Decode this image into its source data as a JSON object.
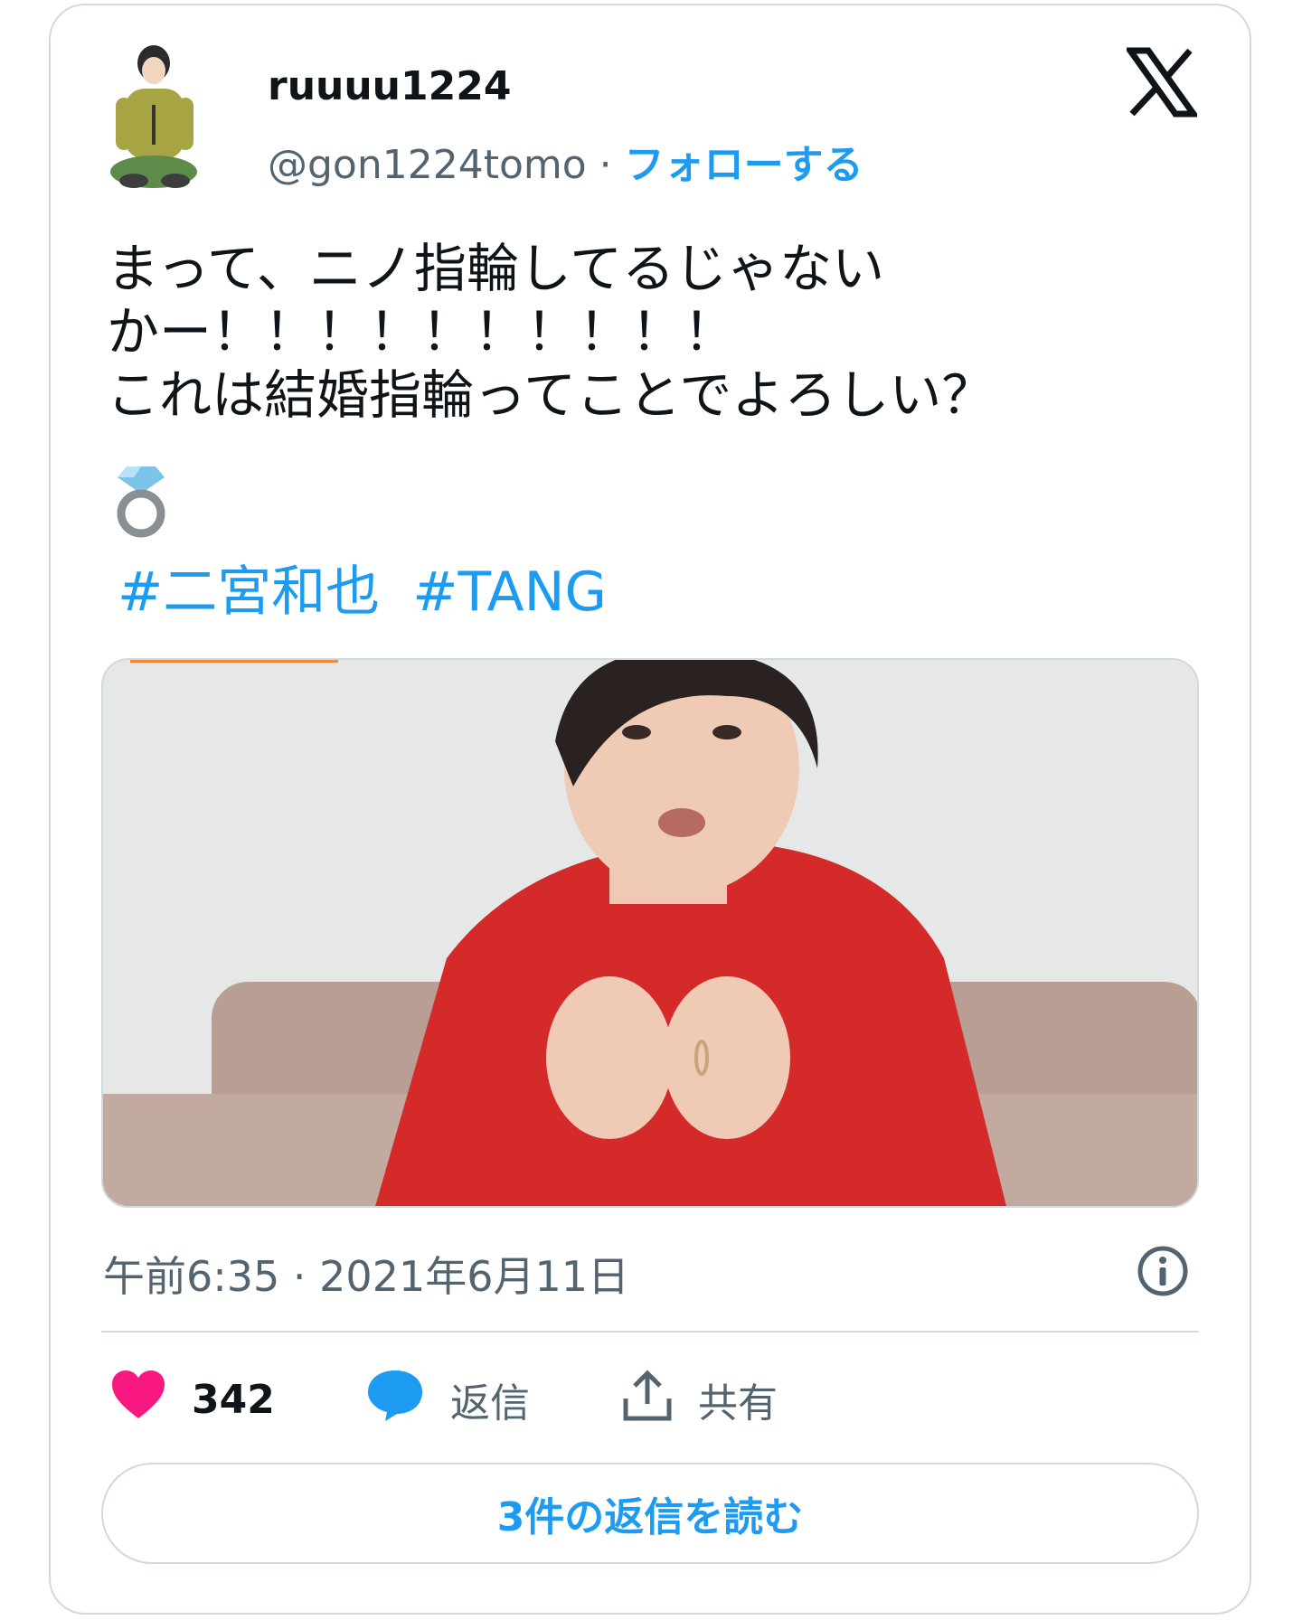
{
  "author": {
    "name": "ruuuu1224",
    "handle": "@gon1224tomo",
    "separator": "·",
    "follow_label": "フォローする"
  },
  "tweet": {
    "lines": [
      "まって、ニノ指輪してるじゃない",
      "かー！！！！！！！！！！",
      "これは結婚指輪ってことでよろしい？"
    ],
    "emoji_icon": "ring-icon",
    "hashtags": [
      "#二宮和也",
      "#TANG"
    ]
  },
  "media": {
    "type": "photo"
  },
  "timestamp": "午前6:35 · 2021年6月11日",
  "actions": {
    "like_count": "342",
    "reply_label": "返信",
    "share_label": "共有"
  },
  "read_replies_label": "3件の返信を読む",
  "colors": {
    "accent": "#1d9bf0",
    "like": "#f91880",
    "text": "#0f1419",
    "muted": "#536471",
    "border": "#cfd9de"
  },
  "icons": [
    "x-logo-icon",
    "info-icon",
    "heart-icon",
    "reply-bubble-icon",
    "share-icon",
    "ring-icon"
  ]
}
